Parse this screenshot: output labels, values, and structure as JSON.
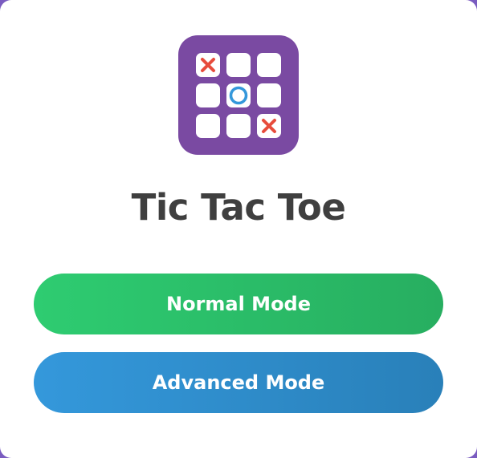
{
  "title": "Tic Tac Toe",
  "logo": {
    "icon": "tic-tac-toe-board-icon",
    "background_color": "#7a4aa2",
    "board": [
      "x",
      "",
      "",
      "",
      "o",
      "",
      "",
      "",
      "x"
    ],
    "x_color": "#e74c3c",
    "o_color": "#3498db"
  },
  "buttons": {
    "normal_label": "Normal Mode",
    "advanced_label": "Advanced Mode"
  },
  "colors": {
    "normal_start": "#2ecc71",
    "normal_end": "#27ae60",
    "advanced_start": "#3498db",
    "advanced_end": "#2980b9",
    "title": "#3f3f3f",
    "page_border": "#7a5cc0"
  }
}
